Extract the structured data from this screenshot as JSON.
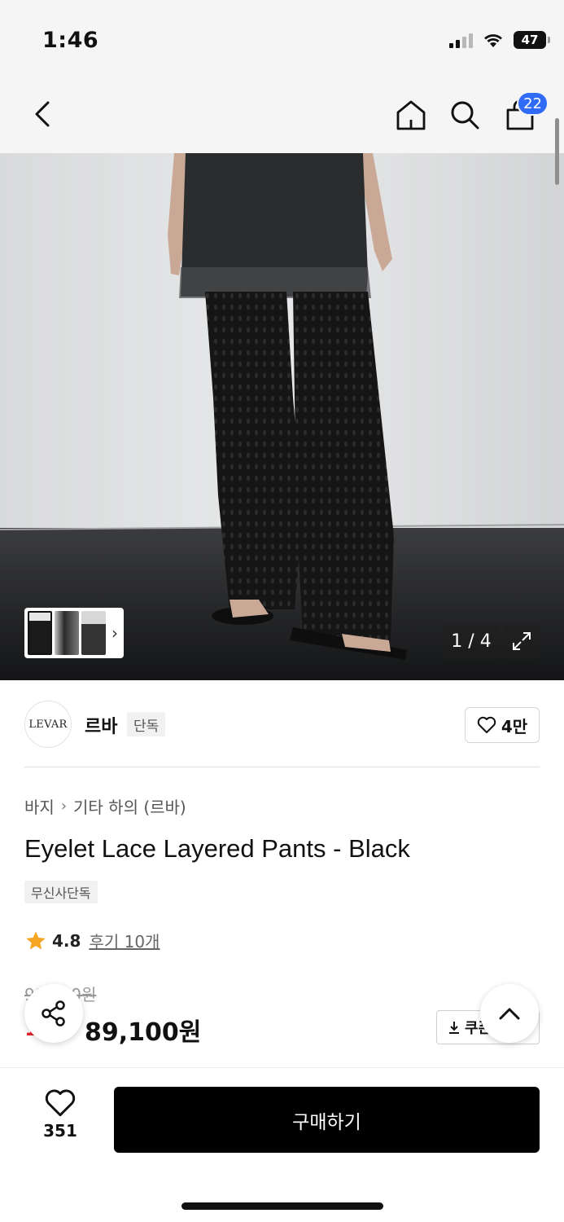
{
  "status_bar": {
    "time": "1:46",
    "battery": "47",
    "icons": [
      "signal-icon",
      "wifi-icon",
      "battery-icon"
    ]
  },
  "top_nav": {
    "icons": [
      "back-chevron-icon",
      "home-icon",
      "search-icon",
      "shopping-bag-icon"
    ],
    "cart_count": "22",
    "accent_color": "#2f6bf6"
  },
  "gallery": {
    "page_counter": "1 / 4",
    "current_page": 1,
    "total_pages": 4,
    "thumbnail_count": 3
  },
  "brand": {
    "logo_text": "LEVAR",
    "name": "르바",
    "exclusive_tag": "단독",
    "likes": "4만"
  },
  "breadcrumb": {
    "category": "바지",
    "subcategory": "기타 하의 (르바)"
  },
  "product": {
    "title": "Eyelet Lace Layered Pants - Black",
    "tag": "무신사단독",
    "rating": "4.8",
    "reviews": "후기 10개",
    "original_price": "99,000원",
    "sale_prefix": "10%",
    "sale_price": "89,100원",
    "sale_color": "#e8232a",
    "coupon_label": "쿠폰"
  },
  "bottom_bar": {
    "wish_count": "351",
    "buy_label": "구매하기"
  }
}
